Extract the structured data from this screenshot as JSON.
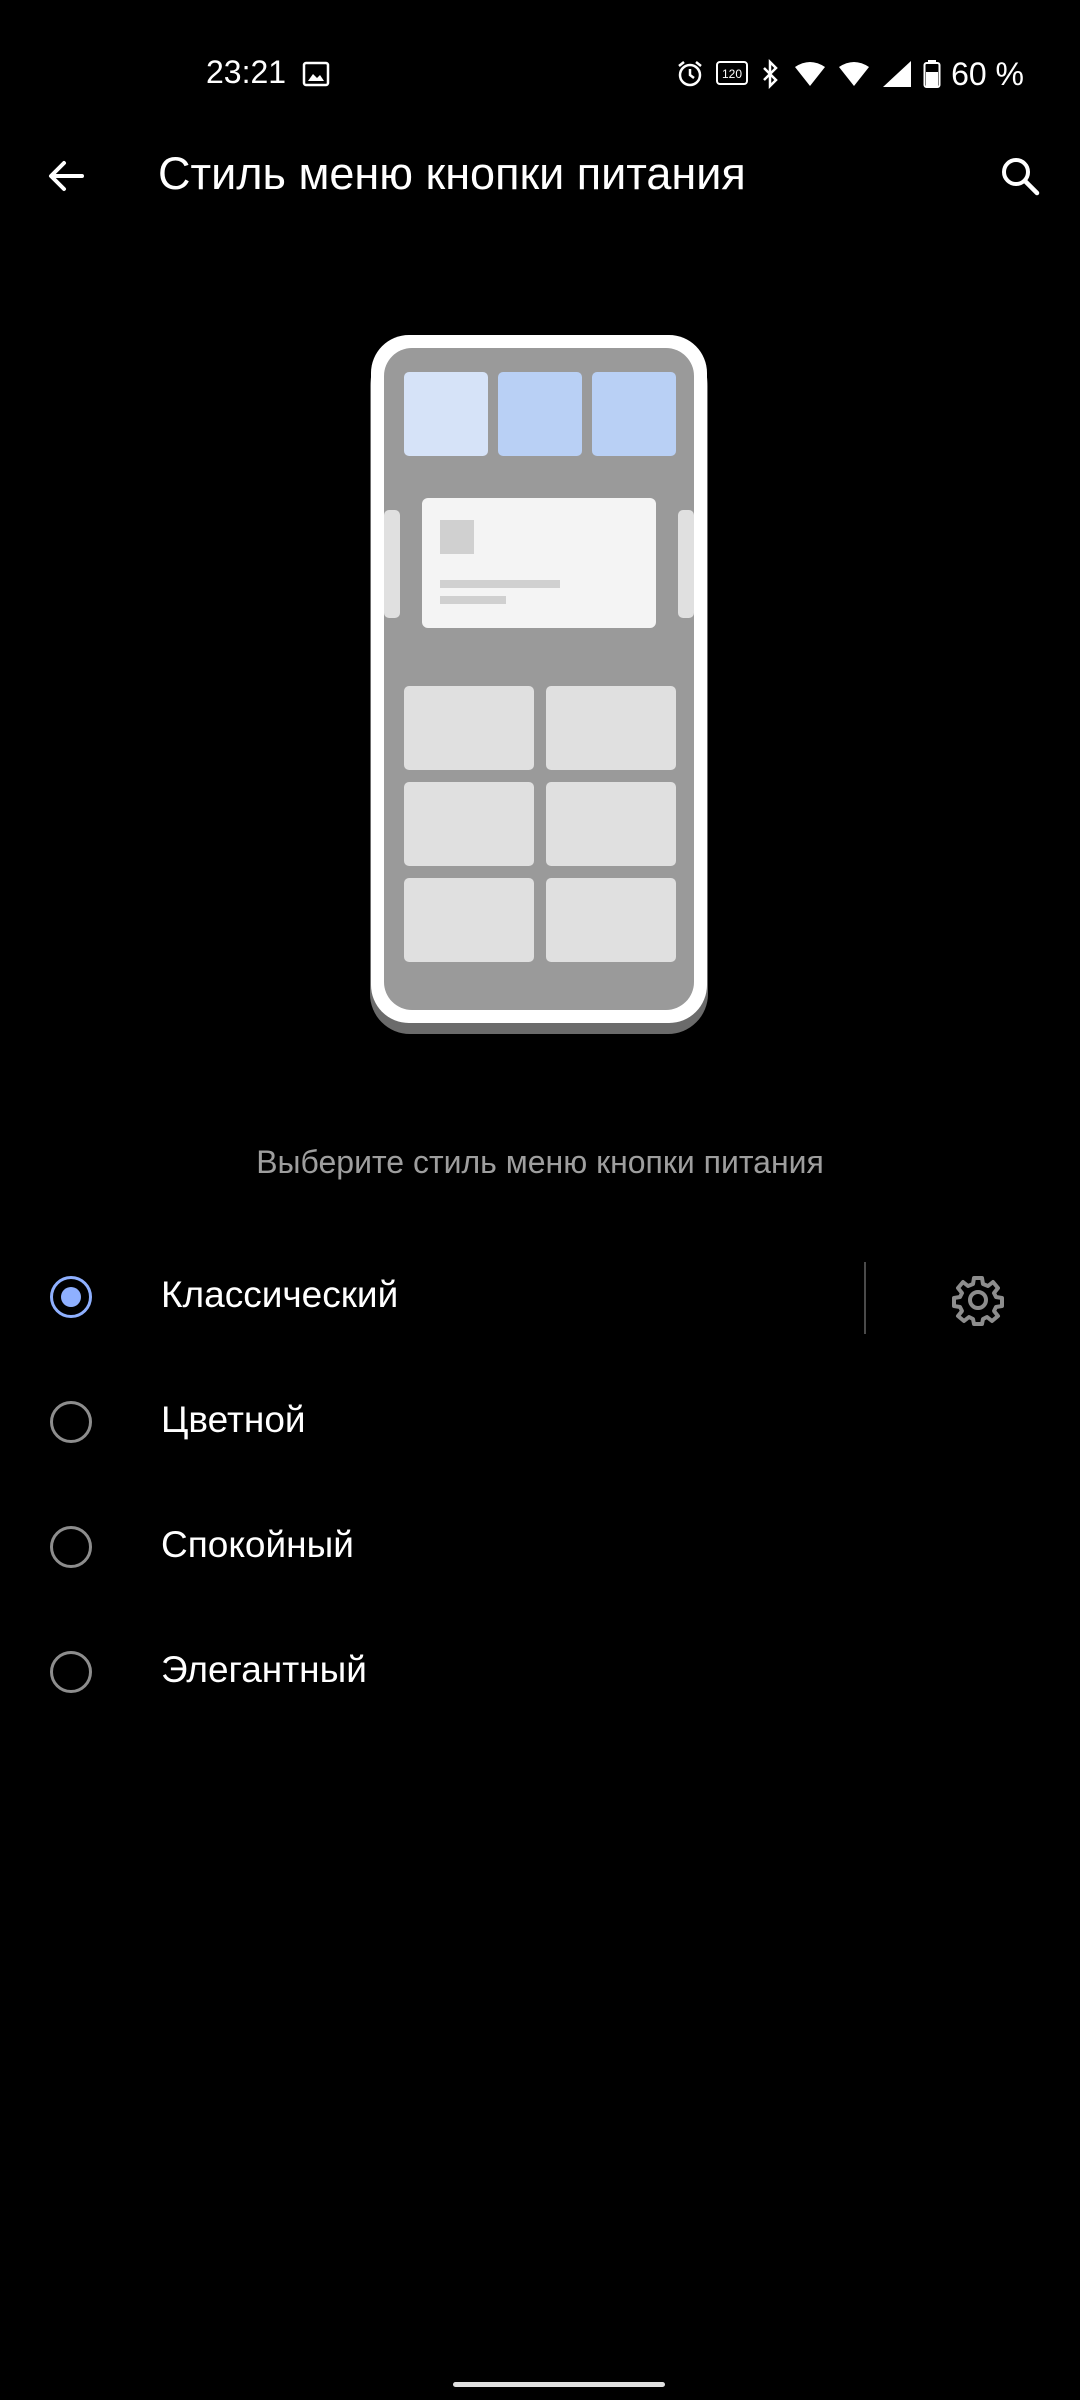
{
  "status_bar": {
    "time": "23:21",
    "battery_text": "60 %",
    "icons": [
      "gallery-icon",
      "alarm-icon",
      "refresh-rate-120hz-icon",
      "bluetooth-icon",
      "wifi6-icon",
      "wifi6-icon",
      "cellular-signal-icon",
      "battery-icon"
    ],
    "refresh_label": "120"
  },
  "app_bar": {
    "title": "Стиль меню кнопки питания",
    "back_icon": "arrow-back-icon",
    "search_icon": "search-icon"
  },
  "illustration": {
    "accent_light": "#d6e3f8",
    "accent": "#b9d0f5"
  },
  "hint": "Выберите стиль меню кнопки питания",
  "options": [
    {
      "label": "Классический",
      "selected": true,
      "has_settings": true
    },
    {
      "label": "Цветной",
      "selected": false
    },
    {
      "label": "Спокойный",
      "selected": false
    },
    {
      "label": "Элегантный",
      "selected": false
    }
  ],
  "colors": {
    "background": "#000000",
    "accent": "#8fb0ff",
    "secondary_text": "#9e9e9e"
  }
}
